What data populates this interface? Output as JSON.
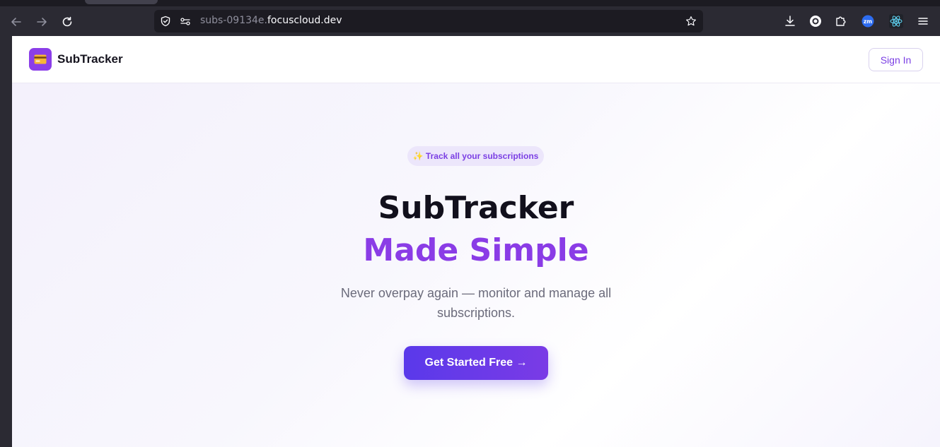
{
  "browser": {
    "url_prefix": "subs-09134e.",
    "url_domain": "focuscloud.dev",
    "icons": {
      "back": "arrow-left-icon",
      "forward": "arrow-right-icon",
      "reload": "reload-icon",
      "security": "shield-icon",
      "permissions": "site-permissions-icon",
      "bookmark": "star-icon",
      "downloads": "download-icon",
      "account": "account-circle-icon",
      "extensions": "puzzle-icon",
      "zoom_extension": "zoom-extension-icon",
      "react_devtools": "react-icon",
      "menu": "hamburger-menu-icon"
    },
    "zoom_extension_label": "zm"
  },
  "site": {
    "header": {
      "logo_icon": "credit-card-icon",
      "brand": "SubTracker",
      "signin_label": "Sign In"
    },
    "hero": {
      "pill": "✨ Track all your subscriptions",
      "title_line1": "SubTracker",
      "title_line2": "Made Simple",
      "subtitle": "Never overpay again — monitor and manage all subscriptions.",
      "cta_label": "Get Started Free →"
    }
  },
  "colors": {
    "accent": "#8a3ce6",
    "cta_start": "#5a39ea",
    "cta_end": "#7a3be6",
    "heading": "#12101c",
    "chrome_bg": "#2b2a33"
  }
}
